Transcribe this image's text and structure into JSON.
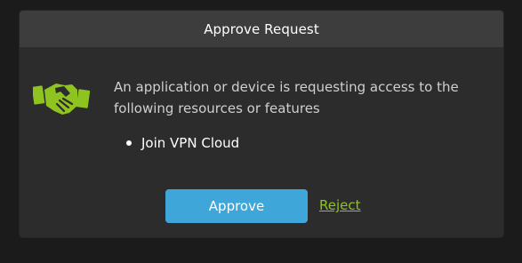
{
  "dialog": {
    "title": "Approve Request",
    "icon": "handshake-icon",
    "message": "An application or device is requesting access to the following resources or features",
    "resources": [
      "Join VPN Cloud"
    ],
    "approve_label": "Approve",
    "reject_label": "Reject"
  },
  "colors": {
    "background": "#1b1b1b",
    "dialog": "#2c2c2c",
    "titlebar": "#3d3d3d",
    "accent_button": "#3ea6d9",
    "link_and_icon": "#8fc31f"
  }
}
